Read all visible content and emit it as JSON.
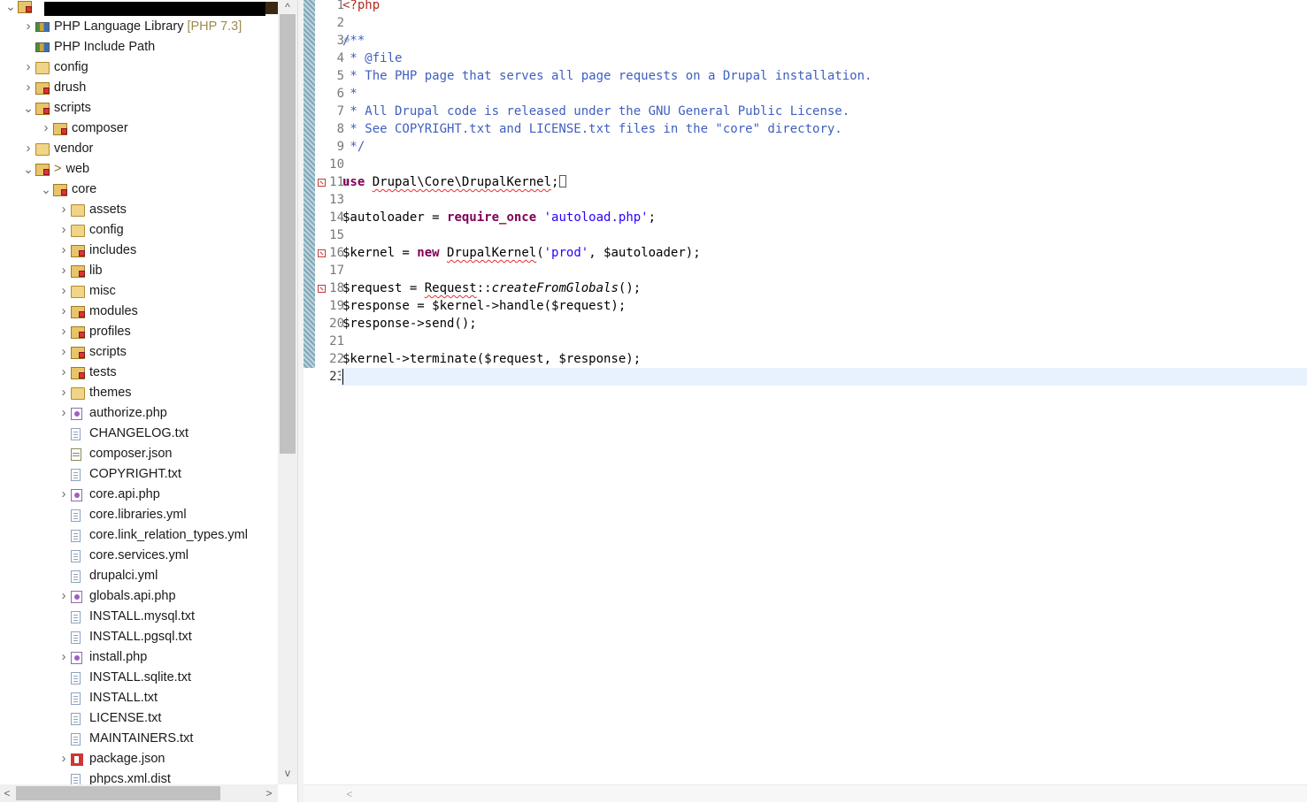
{
  "explorer": {
    "items": [
      {
        "label": "",
        "depth": 0,
        "arrow": "expanded",
        "icon": "project-icon",
        "type": "pkg"
      },
      {
        "label": "PHP Language Library",
        "decor": "[PHP 7.3]",
        "depth": 1,
        "arrow": "collapsed",
        "icon": "library-icon",
        "type": "lib"
      },
      {
        "label": "PHP Include Path",
        "depth": 1,
        "arrow": "",
        "icon": "library-icon",
        "type": "lib"
      },
      {
        "label": "config",
        "depth": 1,
        "arrow": "collapsed",
        "icon": "folder-icon",
        "type": "folder"
      },
      {
        "label": "drush",
        "depth": 1,
        "arrow": "collapsed",
        "icon": "package-folder-icon",
        "type": "pkg"
      },
      {
        "label": "scripts",
        "depth": 1,
        "arrow": "expanded",
        "icon": "package-folder-icon",
        "type": "pkg"
      },
      {
        "label": "composer",
        "depth": 2,
        "arrow": "collapsed",
        "icon": "package-folder-icon",
        "type": "pkg"
      },
      {
        "label": "vendor",
        "depth": 1,
        "arrow": "collapsed",
        "icon": "folder-icon",
        "type": "folder"
      },
      {
        "label": "web",
        "prefix": ">",
        "depth": 1,
        "arrow": "expanded",
        "icon": "package-folder-icon",
        "type": "pkg"
      },
      {
        "label": "core",
        "depth": 2,
        "arrow": "expanded",
        "icon": "package-folder-icon",
        "type": "pkg"
      },
      {
        "label": "assets",
        "depth": 3,
        "arrow": "collapsed",
        "icon": "folder-icon",
        "type": "folder"
      },
      {
        "label": "config",
        "depth": 3,
        "arrow": "collapsed",
        "icon": "folder-icon",
        "type": "folder"
      },
      {
        "label": "includes",
        "depth": 3,
        "arrow": "collapsed",
        "icon": "package-folder-icon",
        "type": "pkg"
      },
      {
        "label": "lib",
        "depth": 3,
        "arrow": "collapsed",
        "icon": "package-folder-icon",
        "type": "pkg"
      },
      {
        "label": "misc",
        "depth": 3,
        "arrow": "collapsed",
        "icon": "folder-icon",
        "type": "folder"
      },
      {
        "label": "modules",
        "depth": 3,
        "arrow": "collapsed",
        "icon": "package-folder-icon",
        "type": "pkg"
      },
      {
        "label": "profiles",
        "depth": 3,
        "arrow": "collapsed",
        "icon": "package-folder-icon",
        "type": "pkg"
      },
      {
        "label": "scripts",
        "depth": 3,
        "arrow": "collapsed",
        "icon": "package-folder-icon",
        "type": "pkg"
      },
      {
        "label": "tests",
        "depth": 3,
        "arrow": "collapsed",
        "icon": "package-folder-icon",
        "type": "pkg"
      },
      {
        "label": "themes",
        "depth": 3,
        "arrow": "collapsed",
        "icon": "folder-icon",
        "type": "folder"
      },
      {
        "label": "authorize.php",
        "depth": 3,
        "arrow": "collapsed",
        "icon": "php-file-icon",
        "type": "php"
      },
      {
        "label": "CHANGELOG.txt",
        "depth": 3,
        "arrow": "",
        "icon": "text-file-icon",
        "type": "file"
      },
      {
        "label": "composer.json",
        "depth": 3,
        "arrow": "",
        "icon": "json-file-icon",
        "type": "json"
      },
      {
        "label": "COPYRIGHT.txt",
        "depth": 3,
        "arrow": "",
        "icon": "text-file-icon",
        "type": "file"
      },
      {
        "label": "core.api.php",
        "depth": 3,
        "arrow": "collapsed",
        "icon": "php-file-icon",
        "type": "php"
      },
      {
        "label": "core.libraries.yml",
        "depth": 3,
        "arrow": "",
        "icon": "text-file-icon",
        "type": "file"
      },
      {
        "label": "core.link_relation_types.yml",
        "depth": 3,
        "arrow": "",
        "icon": "text-file-icon",
        "type": "file"
      },
      {
        "label": "core.services.yml",
        "depth": 3,
        "arrow": "",
        "icon": "text-file-icon",
        "type": "file"
      },
      {
        "label": "drupalci.yml",
        "depth": 3,
        "arrow": "",
        "icon": "text-file-icon",
        "type": "file"
      },
      {
        "label": "globals.api.php",
        "depth": 3,
        "arrow": "collapsed",
        "icon": "php-file-icon",
        "type": "php"
      },
      {
        "label": "INSTALL.mysql.txt",
        "depth": 3,
        "arrow": "",
        "icon": "text-file-icon",
        "type": "file"
      },
      {
        "label": "INSTALL.pgsql.txt",
        "depth": 3,
        "arrow": "",
        "icon": "text-file-icon",
        "type": "file"
      },
      {
        "label": "install.php",
        "depth": 3,
        "arrow": "collapsed",
        "icon": "php-file-icon",
        "type": "php"
      },
      {
        "label": "INSTALL.sqlite.txt",
        "depth": 3,
        "arrow": "",
        "icon": "text-file-icon",
        "type": "file"
      },
      {
        "label": "INSTALL.txt",
        "depth": 3,
        "arrow": "",
        "icon": "text-file-icon",
        "type": "file"
      },
      {
        "label": "LICENSE.txt",
        "depth": 3,
        "arrow": "",
        "icon": "text-file-icon",
        "type": "file"
      },
      {
        "label": "MAINTAINERS.txt",
        "depth": 3,
        "arrow": "",
        "icon": "text-file-icon",
        "type": "file"
      },
      {
        "label": "package.json",
        "depth": 3,
        "arrow": "collapsed",
        "icon": "npm-icon",
        "type": "npm"
      },
      {
        "label": "phpcs.xml.dist",
        "depth": 3,
        "arrow": "",
        "icon": "text-file-icon",
        "type": "file"
      }
    ]
  },
  "editor": {
    "current_line": 23,
    "lines": [
      {
        "n": "1",
        "parts": [
          {
            "t": "<?php",
            "c": "tag"
          }
        ]
      },
      {
        "n": "2",
        "parts": []
      },
      {
        "n": "3",
        "fold": "⊖",
        "parts": [
          {
            "t": "/**",
            "c": "cmt"
          }
        ]
      },
      {
        "n": "4",
        "parts": [
          {
            "t": " * @file",
            "c": "cmt"
          }
        ]
      },
      {
        "n": "5",
        "parts": [
          {
            "t": " * The PHP page that serves all page requests on a Drupal installation.",
            "c": "cmt"
          }
        ]
      },
      {
        "n": "6",
        "parts": [
          {
            "t": " *",
            "c": "cmt"
          }
        ]
      },
      {
        "n": "7",
        "parts": [
          {
            "t": " * All Drupal code is released under the GNU General Public License.",
            "c": "cmt"
          }
        ]
      },
      {
        "n": "8",
        "parts": [
          {
            "t": " * See COPYRIGHT.txt and LICENSE.txt files in the \"core\" directory.",
            "c": "cmt"
          }
        ]
      },
      {
        "n": "9",
        "parts": [
          {
            "t": " */",
            "c": "cmt"
          }
        ]
      },
      {
        "n": "10",
        "parts": []
      },
      {
        "n": "11",
        "fold": "⊕",
        "error": true,
        "parts": [
          {
            "t": "use",
            "c": "kw"
          },
          {
            "t": " "
          },
          {
            "t": "Drupal\\Core\\DrupalKernel",
            "c": "squig"
          },
          {
            "t": ";"
          },
          {
            "t": "",
            "c": "box"
          }
        ]
      },
      {
        "n": "13",
        "parts": []
      },
      {
        "n": "14",
        "parts": [
          {
            "t": "$autoloader = "
          },
          {
            "t": "require_once",
            "c": "kw"
          },
          {
            "t": " "
          },
          {
            "t": "'autoload.php'",
            "c": "str"
          },
          {
            "t": ";"
          }
        ]
      },
      {
        "n": "15",
        "parts": []
      },
      {
        "n": "16",
        "error": true,
        "parts": [
          {
            "t": "$kernel = "
          },
          {
            "t": "new",
            "c": "kw"
          },
          {
            "t": " "
          },
          {
            "t": "DrupalKernel",
            "c": "squig"
          },
          {
            "t": "("
          },
          {
            "t": "'prod'",
            "c": "str"
          },
          {
            "t": ", $autoloader);"
          }
        ]
      },
      {
        "n": "17",
        "parts": []
      },
      {
        "n": "18",
        "error": true,
        "parts": [
          {
            "t": "$request = "
          },
          {
            "t": "Request",
            "c": "squig"
          },
          {
            "t": "::"
          },
          {
            "t": "createFromGlobals",
            "c": "ital"
          },
          {
            "t": "();"
          }
        ]
      },
      {
        "n": "19",
        "parts": [
          {
            "t": "$response = $kernel->handle($request);"
          }
        ]
      },
      {
        "n": "20",
        "parts": [
          {
            "t": "$response->send();"
          }
        ]
      },
      {
        "n": "21",
        "parts": []
      },
      {
        "n": "22",
        "parts": [
          {
            "t": "$kernel->terminate($request, $response);"
          }
        ]
      },
      {
        "n": "23",
        "parts": []
      }
    ]
  },
  "scroll_glyphs": {
    "up": "^",
    "down": "v",
    "left": "<",
    "right": ">"
  }
}
